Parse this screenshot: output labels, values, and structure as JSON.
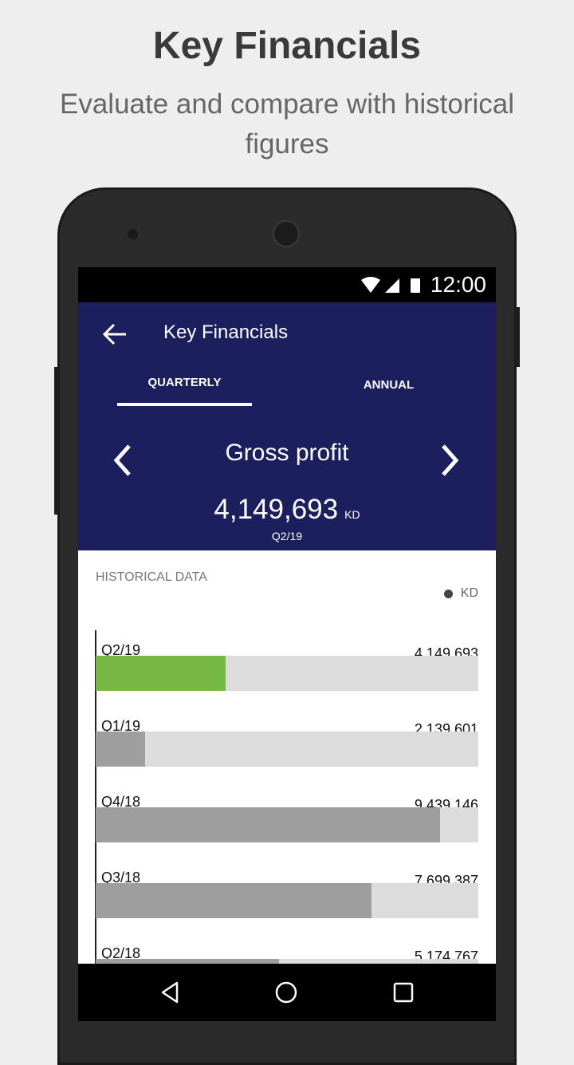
{
  "promo": {
    "title": "Key Financials",
    "subtitle": "Evaluate and compare with historical figures"
  },
  "status_bar": {
    "time": "12:00",
    "icons": [
      "wifi-icon",
      "signal-icon",
      "battery-icon"
    ]
  },
  "app_bar": {
    "title": "Key Financials"
  },
  "tabs": [
    {
      "label": "QUARTERLY",
      "active": true
    },
    {
      "label": "ANNUAL",
      "active": false
    }
  ],
  "metric": {
    "name": "Gross profit",
    "value": "4,149,693",
    "unit": "KD",
    "period": "Q2/19"
  },
  "history": {
    "heading": "HISTORICAL DATA",
    "legend": "KD",
    "rows": [
      {
        "period": "Q2/19",
        "value": "4,149,693",
        "fill": 0.34,
        "color": "#76b843"
      },
      {
        "period": "Q1/19",
        "value": "2,139,601",
        "fill": 0.13,
        "color": "#9e9e9e"
      },
      {
        "period": "Q4/18",
        "value": "9,439,146",
        "fill": 0.9,
        "color": "#9e9e9e"
      },
      {
        "period": "Q3/18",
        "value": "7,699,387",
        "fill": 0.72,
        "color": "#9e9e9e"
      },
      {
        "period": "Q2/18",
        "value": "5,174,767",
        "fill": 0.48,
        "color": "#9e9e9e"
      }
    ]
  },
  "colors": {
    "header": "#1c1f5e",
    "accent": "#76b843",
    "track": "#dcdcdc"
  }
}
